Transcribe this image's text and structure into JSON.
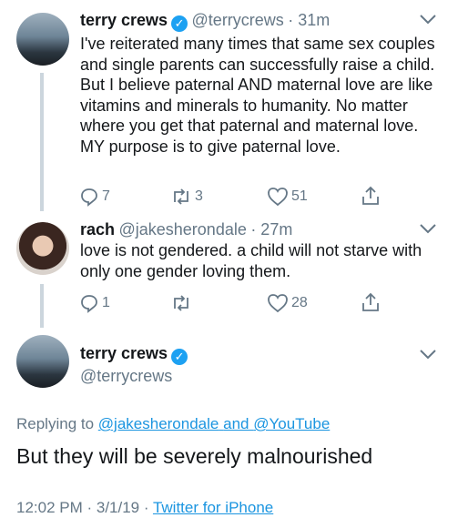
{
  "tweet1": {
    "name": "terry crews",
    "handle": "@terrycrews",
    "time": "· 31m",
    "text": "I've reiterated many times that same sex couples and single parents can successfully raise a child. But I believe paternal AND maternal love are like vitamins and minerals to humanity. No matter where you get that paternal and maternal love. MY purpose is to give paternal love.",
    "reply_count": "7",
    "retweet_count": "3",
    "like_count": "51"
  },
  "tweet2": {
    "name": "rach",
    "handle": "@jakesherondale",
    "time": "· 27m",
    "text": "love is not gendered. a child will not starve with only one gender loving them.",
    "reply_count": "1",
    "retweet_count": "",
    "like_count": "28"
  },
  "main": {
    "name": "terry crews",
    "handle": "@terrycrews",
    "replying_prefix": "Replying to",
    "replying_to_1": "@jakesherondale",
    "replying_and": "and",
    "replying_to_2": "@YouTube",
    "text": "But they will be severely malnourished",
    "timestamp": "12:02 PM · 3/1/19 ·",
    "source": "Twitter for iPhone"
  },
  "icons": {
    "verified": "verified-badge-icon",
    "chevron": "chevron-down-icon",
    "reply": "reply-icon",
    "retweet": "retweet-icon",
    "like": "heart-icon",
    "share": "share-icon"
  },
  "colors": {
    "accent": "#1da1f2",
    "link": "#1b95e0",
    "muted": "#657786"
  }
}
